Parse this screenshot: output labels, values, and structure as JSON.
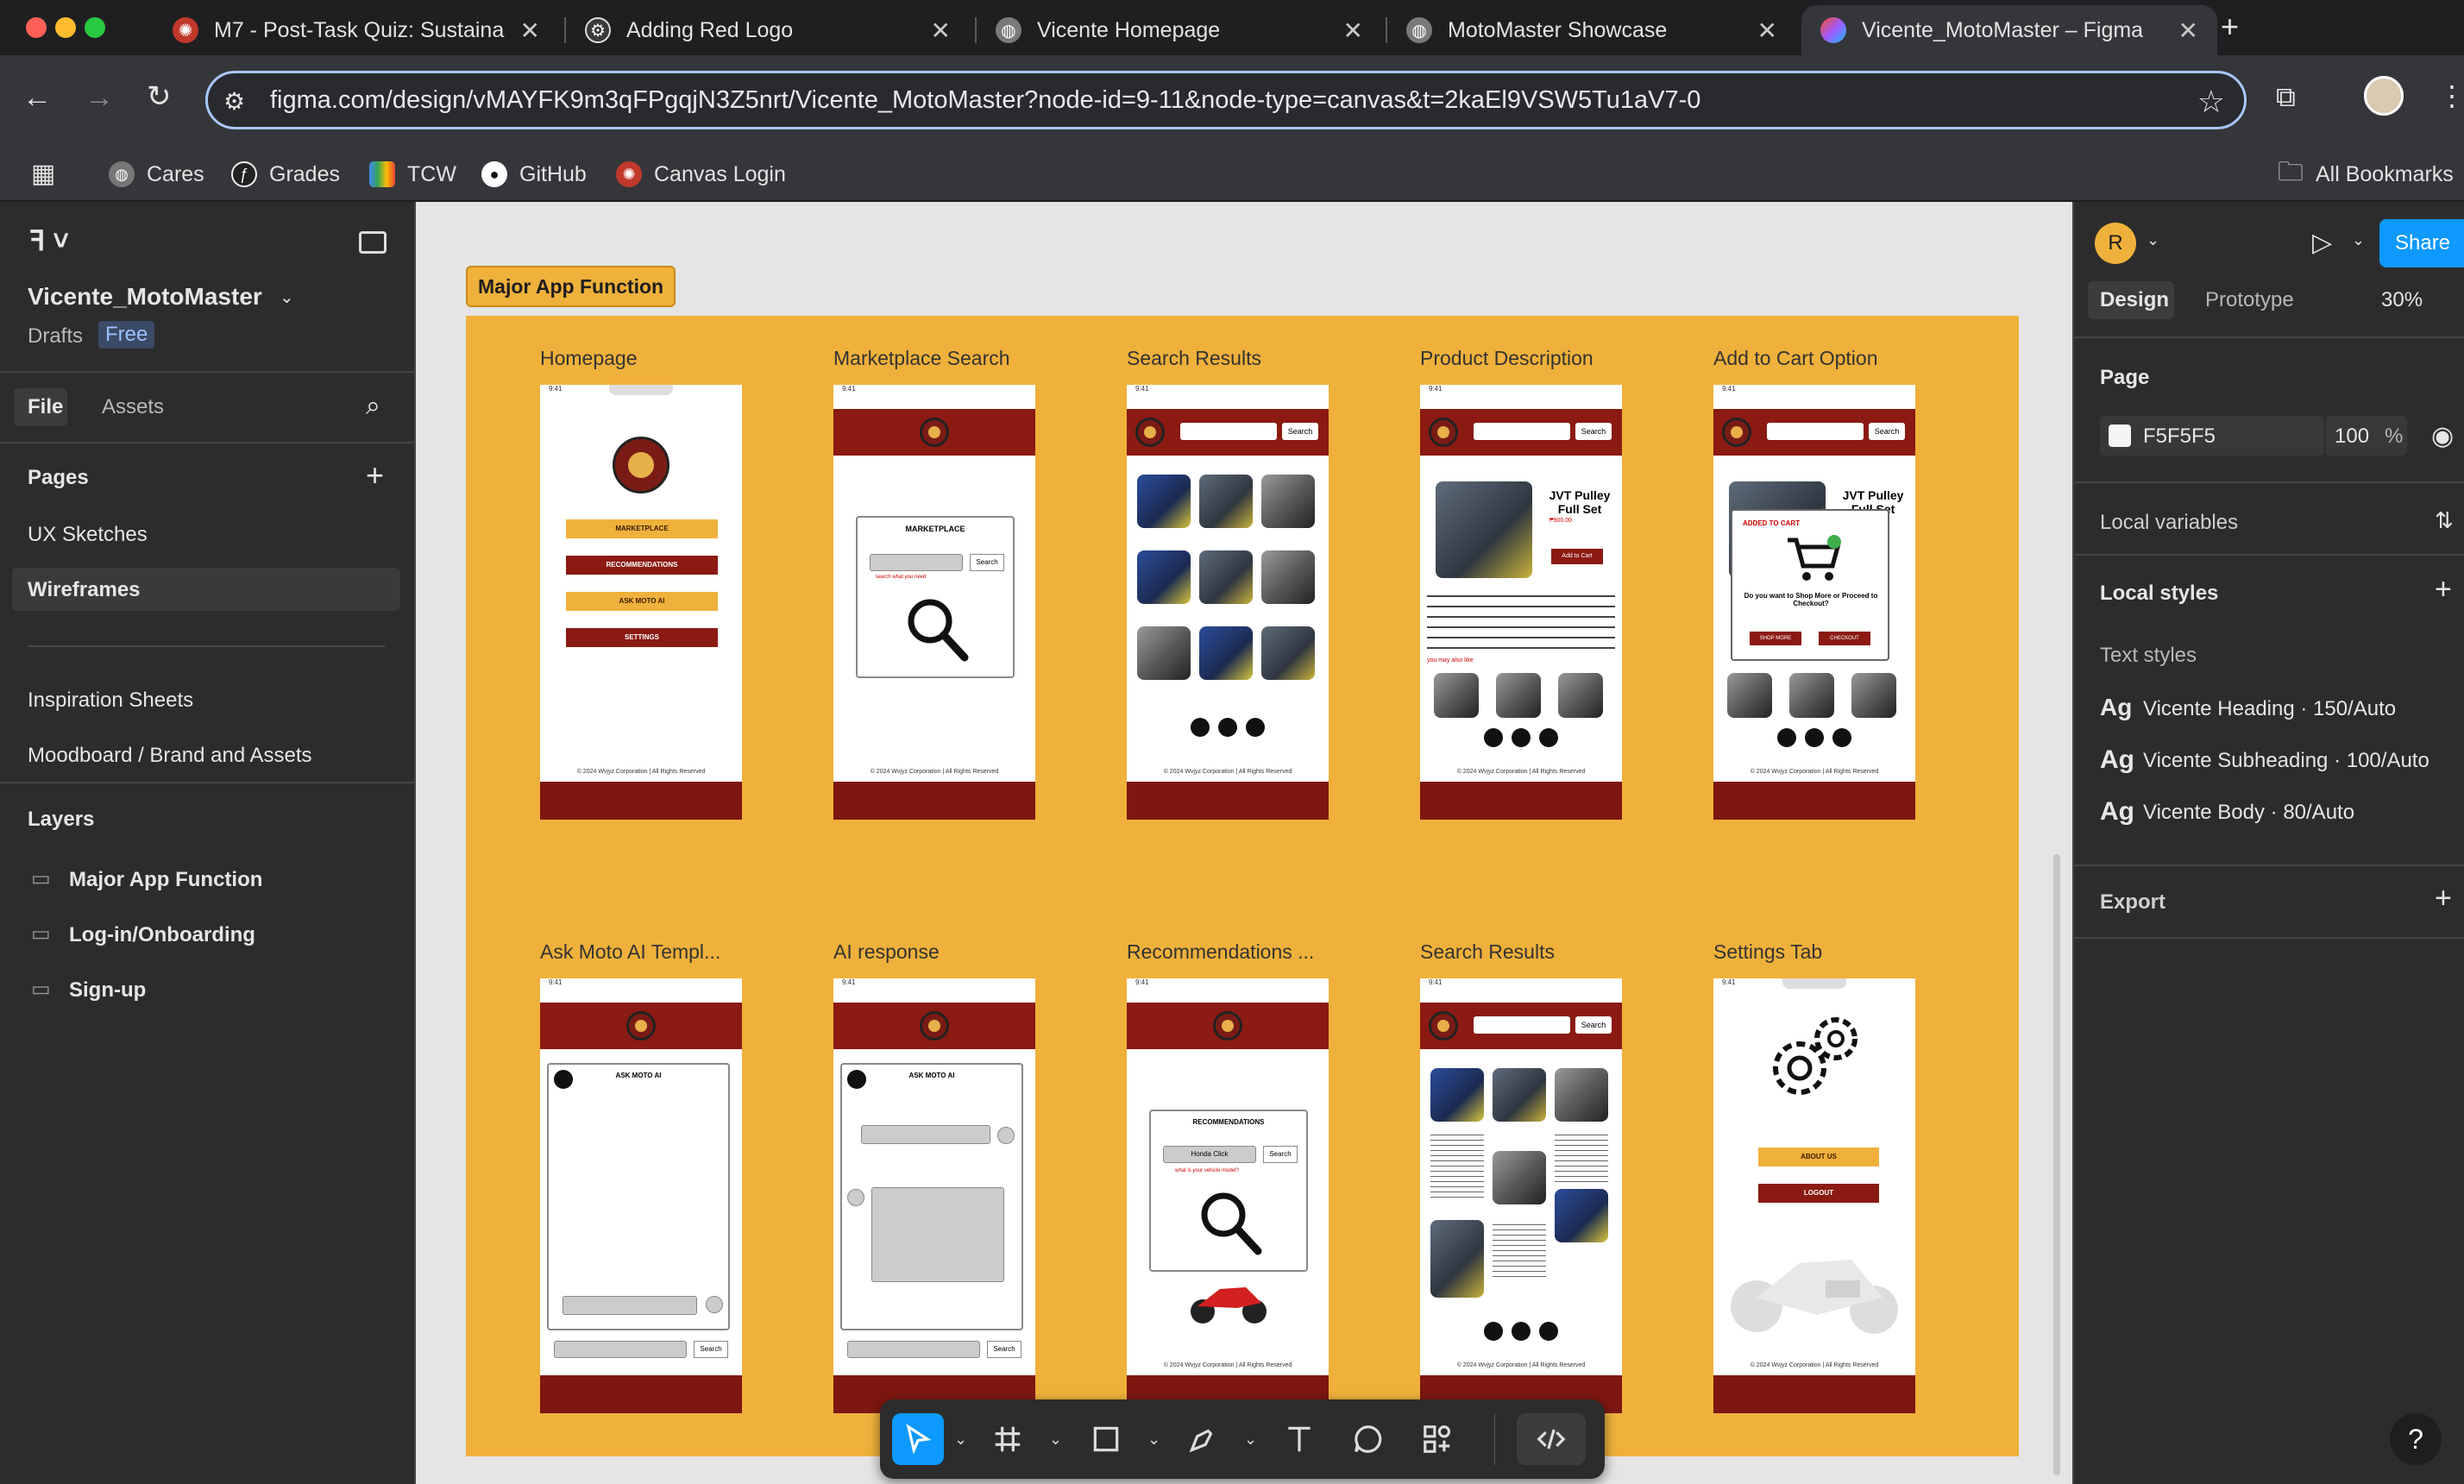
{
  "browser": {
    "tabs": [
      {
        "title": "M7 - Post-Task Quiz: Sustaina",
        "icon": "canvas-icon"
      },
      {
        "title": "Adding Red Logo",
        "icon": "openai-icon"
      },
      {
        "title": "Vicente Homepage",
        "icon": "globe-icon"
      },
      {
        "title": "MotoMaster Showcase",
        "icon": "globe-icon"
      },
      {
        "title": "Vicente_MotoMaster – Figma",
        "icon": "figma-icon"
      }
    ],
    "url": "figma.com/design/vMAYFK9m3qFPgqjN3Z5nrt/Vicente_MotoMaster?node-id=9-11&node-type=canvas&t=2kaEl9VSW5Tu1aV7-0",
    "bookmarks": [
      "Cares",
      "Grades",
      "TCW",
      "GitHub",
      "Canvas Login"
    ],
    "all_bookmarks": "All Bookmarks"
  },
  "left_panel": {
    "file_name": "Vicente_MotoMaster",
    "drafts": "Drafts",
    "plan": "Free",
    "tabs": [
      "File",
      "Assets"
    ],
    "pages_heading": "Pages",
    "pages": [
      "UX Sketches",
      "Wireframes",
      "Inspiration Sheets",
      "Moodboard / Brand and Assets"
    ],
    "layers_heading": "Layers",
    "layers": [
      "Major App Function",
      "Log-in/Onboarding",
      "Sign-up"
    ]
  },
  "canvas": {
    "section_label": "Major App Function",
    "frames": [
      "Homepage",
      "Marketplace Search",
      "Search Results",
      "Product Description",
      "Add to Cart Option",
      "Ask Moto AI Templ...",
      "AI response",
      "Recommendations ...",
      "Search Results",
      "Settings Tab"
    ],
    "phone": {
      "time": "9:41",
      "copyright": "© 2024 Wvjyz Corporation | All Rights Reserved",
      "search_btn": "Search",
      "home_buttons": [
        "MARKETPLACE",
        "RECOMMENDATIONS",
        "ASK MOTO AI",
        "SETTINGS"
      ],
      "marketplace_title": "MARKETPLACE",
      "marketplace_hint": "search what you need",
      "product_title": "JVT Pulley Full Set",
      "product_price": "₱900.00",
      "add_to_cart": "Add to Cart",
      "you_may_like": "you may also like",
      "added_to_cart": "ADDED TO CART",
      "added_question": "Do you want to Shop More or Proceed to Checkout?",
      "shop_more": "SHOP MORE",
      "checkout": "CHECKOUT",
      "ask_moto_ai": "ASK MOTO AI",
      "recommendations_title": "RECOMMENDATIONS",
      "rec_input": "Honda Click",
      "rec_hint": "what is your vehicle model?",
      "about_us": "ABOUT US",
      "logout": "LOGOUT"
    }
  },
  "right_panel": {
    "avatar": "R",
    "share": "Share",
    "tabs": [
      "Design",
      "Prototype"
    ],
    "zoom": "30%",
    "page_heading": "Page",
    "page_color": "F5F5F5",
    "page_opacity": "100",
    "percent": "%",
    "local_variables": "Local variables",
    "local_styles": "Local styles",
    "text_styles_heading": "Text styles",
    "text_styles": [
      "Vicente Heading · 150/Auto",
      "Vicente Subheading · 100/Auto",
      "Vicente Body · 80/Auto"
    ],
    "text_style_glyph": "Ag",
    "export": "Export"
  },
  "help": "?"
}
